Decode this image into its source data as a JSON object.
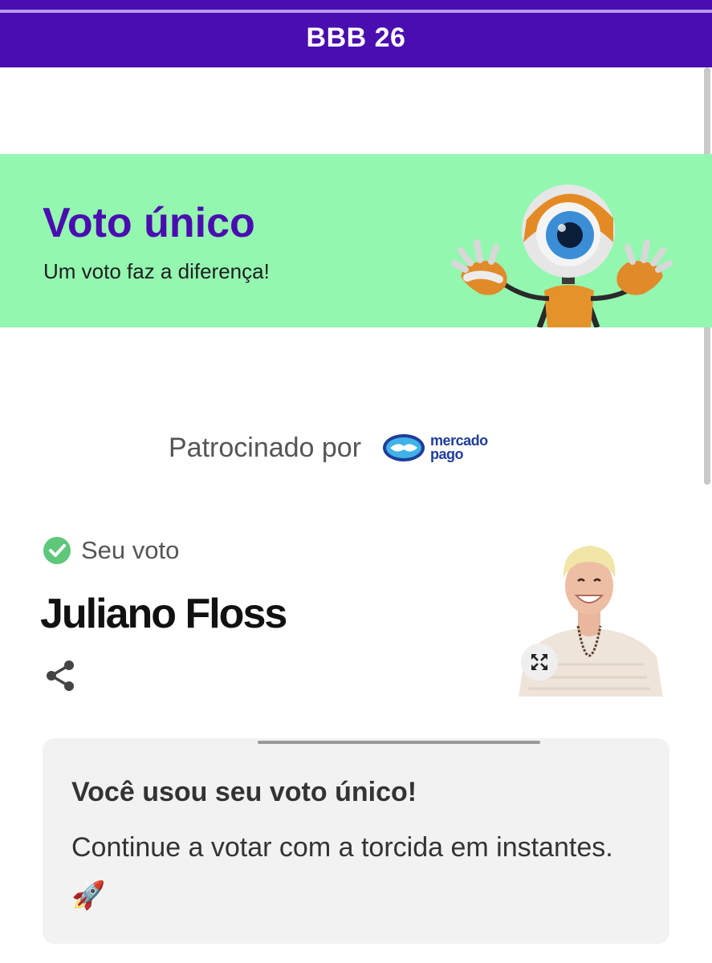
{
  "header": {
    "title": "BBB 26"
  },
  "banner": {
    "title": "Voto único",
    "subtitle": "Um voto faz a diferença!",
    "mascot_icon": "big-brother-eye-robot"
  },
  "sponsor": {
    "label": "Patrocinado por",
    "logo_line1": "mercado",
    "logo_line2": "pago"
  },
  "vote": {
    "status_label": "Seu voto",
    "status_icon": "check-circle-icon",
    "candidate_name": "Juliano Floss",
    "share_icon": "share-icon",
    "expand_icon": "expand-icon"
  },
  "info": {
    "title": "Você usou seu voto único!",
    "message": "Continue a votar com a torcida em instantes. 🚀"
  },
  "colors": {
    "header_bg": "#4a0db0",
    "banner_bg": "#94f7b0",
    "accent_purple": "#4a0db0",
    "check_green": "#5ec77a",
    "card_bg": "#f2f2f2"
  }
}
